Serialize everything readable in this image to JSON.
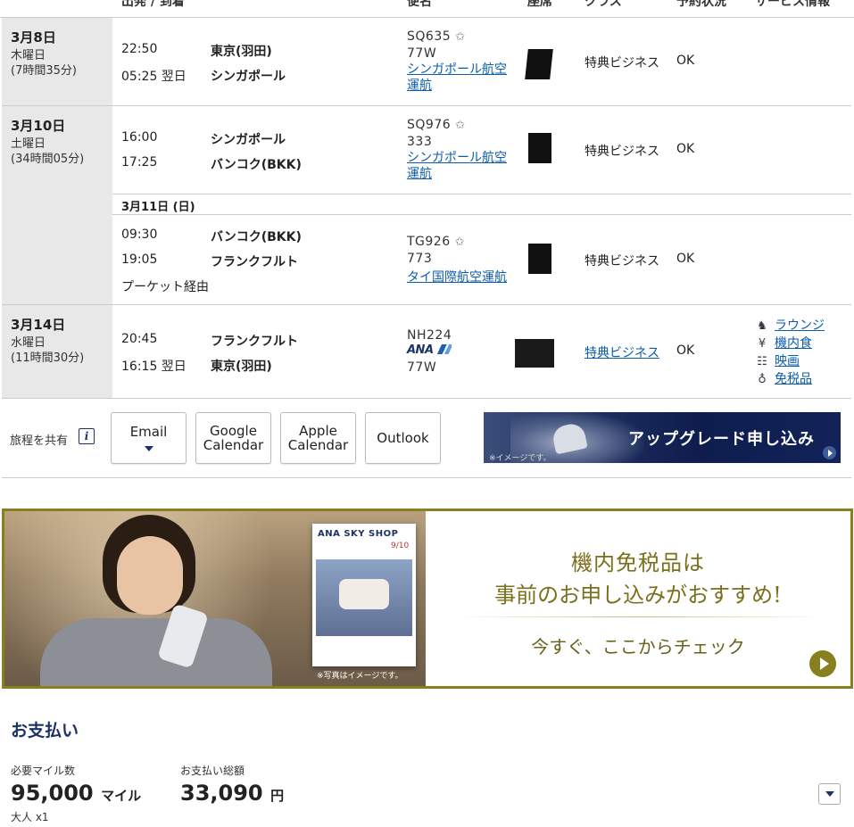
{
  "header": {
    "col_dep_arr": "出発 / 到着",
    "col_flight": "便名",
    "col_seat": "座席",
    "col_class": "クラス",
    "col_status": "予約状況",
    "col_service": "サービス情報"
  },
  "segments": [
    {
      "date": "3月8日",
      "weekday": "木曜日",
      "duration": "(7時間35分)",
      "legs": [
        {
          "dep_time": "22:50",
          "dep_city": "東京(羽田)",
          "arr_time": "05:25 翌日",
          "arr_city": "シンガポール",
          "flight": "SQ635",
          "aircraft": "77W",
          "operated": "シンガポール航空運航",
          "class": "特典ビジネス",
          "status": "OK"
        }
      ]
    },
    {
      "date": "3月10日",
      "weekday": "土曜日",
      "duration": "(34時間05分)",
      "legs": [
        {
          "dep_time": "16:00",
          "dep_city": "シンガポール",
          "arr_time": "17:25",
          "arr_city": "バンコク(BKK)",
          "flight": "SQ976",
          "aircraft": "333",
          "operated": "シンガポール航空運航",
          "class": "特典ビジネス",
          "status": "OK"
        },
        {
          "day_label": "3月11日 (日)",
          "dep_time": "09:30",
          "dep_city": "バンコク(BKK)",
          "arr_time": "19:05",
          "arr_city": "フランクフルト",
          "via": "プーケット経由",
          "flight": "TG926",
          "aircraft": "773",
          "operated": "タイ国際航空運航",
          "class": "特典ビジネス",
          "status": "OK"
        }
      ]
    },
    {
      "date": "3月14日",
      "weekday": "水曜日",
      "duration": "(11時間30分)",
      "legs": [
        {
          "dep_time": "20:45",
          "dep_city": "フランクフルト",
          "arr_time": "16:15 翌日",
          "arr_city": "東京(羽田)",
          "flight": "NH224",
          "airline_logo": "ANA",
          "aircraft": "77W",
          "class": "特典ビジネス",
          "status": "OK",
          "services": [
            "ラウンジ",
            "機内食",
            "映画",
            "免税品"
          ]
        }
      ]
    }
  ],
  "share": {
    "label": "旅程を共有",
    "email": "Email",
    "google": [
      "Google",
      "Calendar"
    ],
    "apple": [
      "Apple",
      "Calendar"
    ],
    "outlook": "Outlook"
  },
  "upgrade_banner": {
    "title": "アップグレード申し込み",
    "caption": "※イメージです。"
  },
  "dutyfree_banner": {
    "magazine": "ANA SKY SHOP",
    "issue": "9/10",
    "photo_note": "※写真はイメージです。",
    "line1": "機内免税品は",
    "line2": "事前のお申し込みがおすすめ!",
    "line3": "今すぐ、ここからチェック",
    "accent": "#8a7f1e"
  },
  "payment": {
    "title": "お支払い",
    "miles_label": "必要マイル数",
    "miles_value": "95,000",
    "miles_unit": "マイル",
    "pax": "大人 x1",
    "total_label": "お支払い総額",
    "total_value": "33,090",
    "total_unit": "円"
  }
}
